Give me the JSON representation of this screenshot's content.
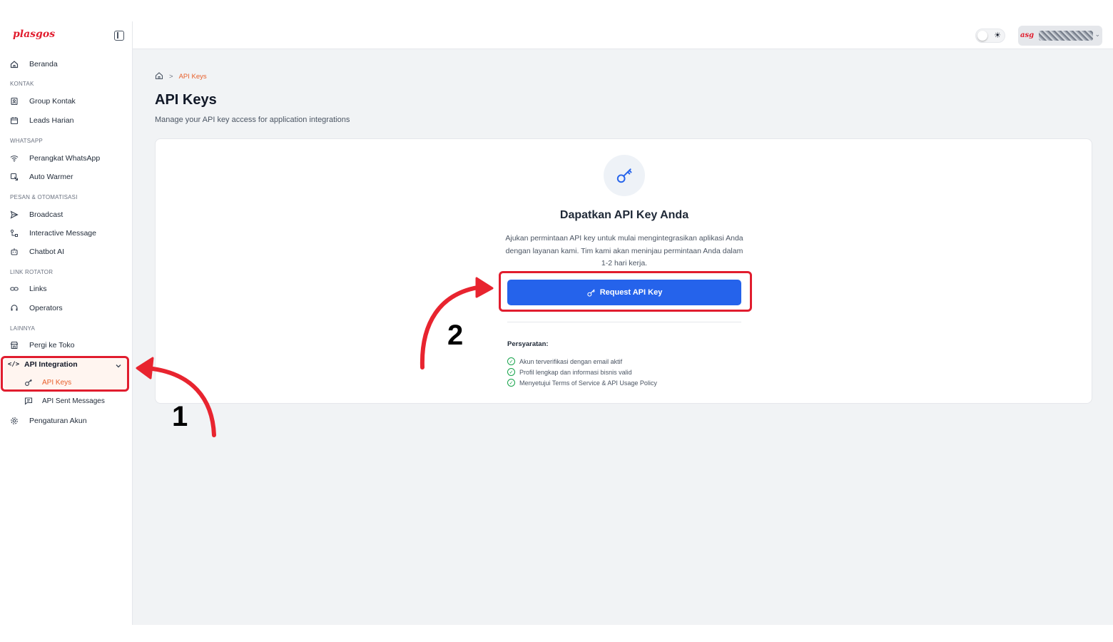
{
  "brand": {
    "logo_text": "plasgos",
    "accent_color": "#e11d2e"
  },
  "sidebar": {
    "collapse_icon": "sidebar-collapse-icon",
    "sections": {
      "kontak": "KONTAK",
      "whatsapp": "WHATSAPP",
      "pesan": "PESAN & OTOMATISASI",
      "link_rotator": "LINK ROTATOR",
      "lainnya": "LAINNYA"
    },
    "items": {
      "beranda": "Beranda",
      "group_kontak": "Group Kontak",
      "leads_harian": "Leads Harian",
      "perangkat_whatsapp": "Perangkat WhatsApp",
      "auto_warmer": "Auto Warmer",
      "broadcast": "Broadcast",
      "interactive_message": "Interactive Message",
      "chatbot_ai": "Chatbot AI",
      "links": "Links",
      "operators": "Operators",
      "pergi_ke_toko": "Pergi ke Toko",
      "api_integration": "API Integration",
      "api_keys": "API Keys",
      "api_sent_messages": "API Sent Messages",
      "pengaturan_akun": "Pengaturan Akun"
    }
  },
  "topbar": {
    "theme_icon": "sun-icon",
    "user_name_prefix": "asg"
  },
  "breadcrumb": {
    "home_icon": "home-icon",
    "separator": ">",
    "current": "API Keys"
  },
  "page": {
    "title": "API Keys",
    "subtitle": "Manage your API key access for application integrations"
  },
  "card": {
    "icon": "key-icon",
    "title": "Dapatkan API Key Anda",
    "description": "Ajukan permintaan API key untuk mulai mengintegrasikan aplikasi Anda dengan layanan kami. Tim kami akan meninjau permintaan Anda dalam 1-2 hari kerja.",
    "button_label": "Request API Key",
    "button_color": "#2563eb",
    "requirements_title": "Persyaratan:",
    "requirements": [
      "Akun terverifikasi dengan email aktif",
      "Profil lengkap dan informasi bisnis valid",
      "Menyetujui Terms of Service & API Usage Policy"
    ]
  },
  "annotations": {
    "step1": "1",
    "step2": "2",
    "highlight_color": "#e11d2e"
  },
  "colors": {
    "active_nav": "#e8602c"
  }
}
